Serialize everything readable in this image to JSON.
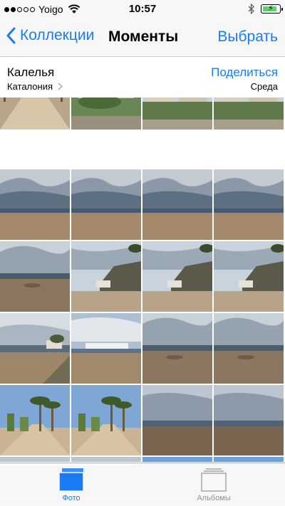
{
  "status": {
    "carrier": "Yoigo",
    "signal_bars": 2,
    "signal_total": 5,
    "time": "10:57",
    "battery_level": 0.85,
    "icons": [
      "wifi-icon",
      "bluetooth-icon",
      "battery-charging-icon"
    ]
  },
  "nav": {
    "back_label": "Коллекции",
    "title": "Моменты",
    "select_label": "Выбрать"
  },
  "section": {
    "location": "Калелья",
    "region": "Каталония",
    "share_label": "Поделиться",
    "day": "Среда"
  },
  "tabs": {
    "photos_label": "Фото",
    "albums_label": "Альбомы"
  },
  "photos": [
    "promenade",
    "beach-palms",
    "buildings",
    "buildings",
    "beach-clouds",
    "beach-clouds",
    "beach-clouds",
    "beach-clouds",
    "beach-dark",
    "headland",
    "headland",
    "headland",
    "shore-house",
    "pier",
    "beach-dark",
    "beach-dark",
    "palm-walk",
    "palm-walk",
    "sea-grey",
    "sea-grey",
    "sea-grey",
    "sea-grey",
    "town-trees",
    "town-trees"
  ],
  "colors": {
    "accent": "#1a7cf5",
    "battery": "#4cd964"
  }
}
